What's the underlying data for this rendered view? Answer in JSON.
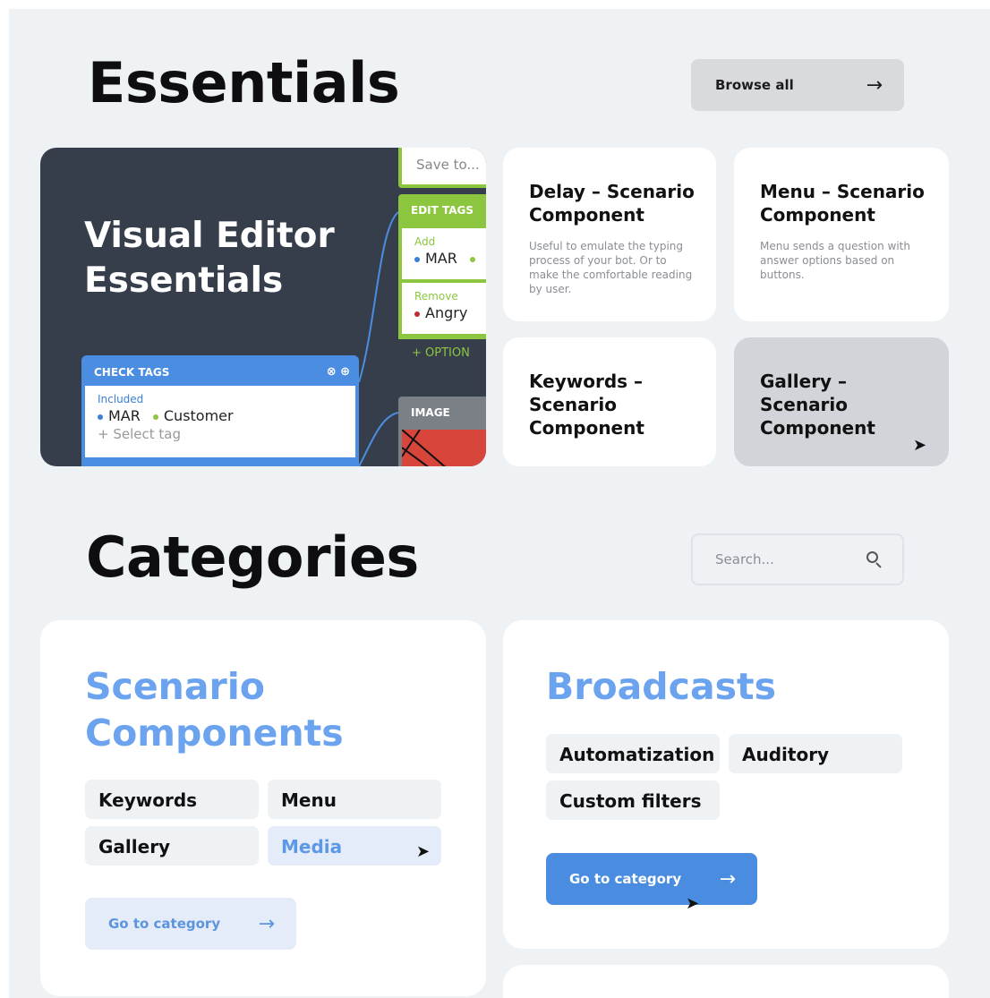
{
  "essentials": {
    "title": "Essentials",
    "browse_label": "Browse all",
    "hero": {
      "title": "Visual Editor\nEssentials",
      "save_placeholder": "Save to...",
      "edit_tags_label": "EDIT TAGS",
      "add_label": "Add",
      "add_tag": "MAR",
      "remove_label": "Remove",
      "remove_tag": "Angry",
      "option_label": "+ OPTION",
      "check_tags_label": "CHECK TAGS",
      "included_label": "Included",
      "included_tag_1": "MAR",
      "included_tag_2": "Customer",
      "select_tag": "+ Select tag",
      "image_label": "IMAGE"
    },
    "cards": [
      {
        "title": "Delay – Scenario\nComponent",
        "description": "Useful to emulate the typing\nprocess of your bot. Or to\nmake the comfortable reading\nby user."
      },
      {
        "title": "Menu – Scenario\nComponent",
        "description": "Menu sends a question with\nanswer options based on\nbuttons."
      },
      {
        "title": "Keywords –\nScenario\nComponent"
      },
      {
        "title": "Gallery –\nScenario\nComponent"
      }
    ]
  },
  "categories": {
    "title": "Categories",
    "search_placeholder": "Search...",
    "scenario": {
      "title": "Scenario\nComponents",
      "chips": [
        "Keywords",
        "Menu",
        "Gallery",
        "Media"
      ],
      "button": "Go to category"
    },
    "broadcasts": {
      "title": "Broadcasts",
      "chips": [
        "Automatization",
        "Auditory",
        "Custom filters"
      ],
      "button": "Go to category"
    }
  },
  "colors": {
    "accent_blue": "#4a8de0",
    "title_blue": "#6ba3ef",
    "hero_bg": "#363e4c",
    "tag_green": "#8cc63f",
    "page_bg": "#eff2f4"
  },
  "icons": {
    "arrow": "arrow-right-icon",
    "search": "search-icon",
    "cursor": "cursor-icon"
  }
}
